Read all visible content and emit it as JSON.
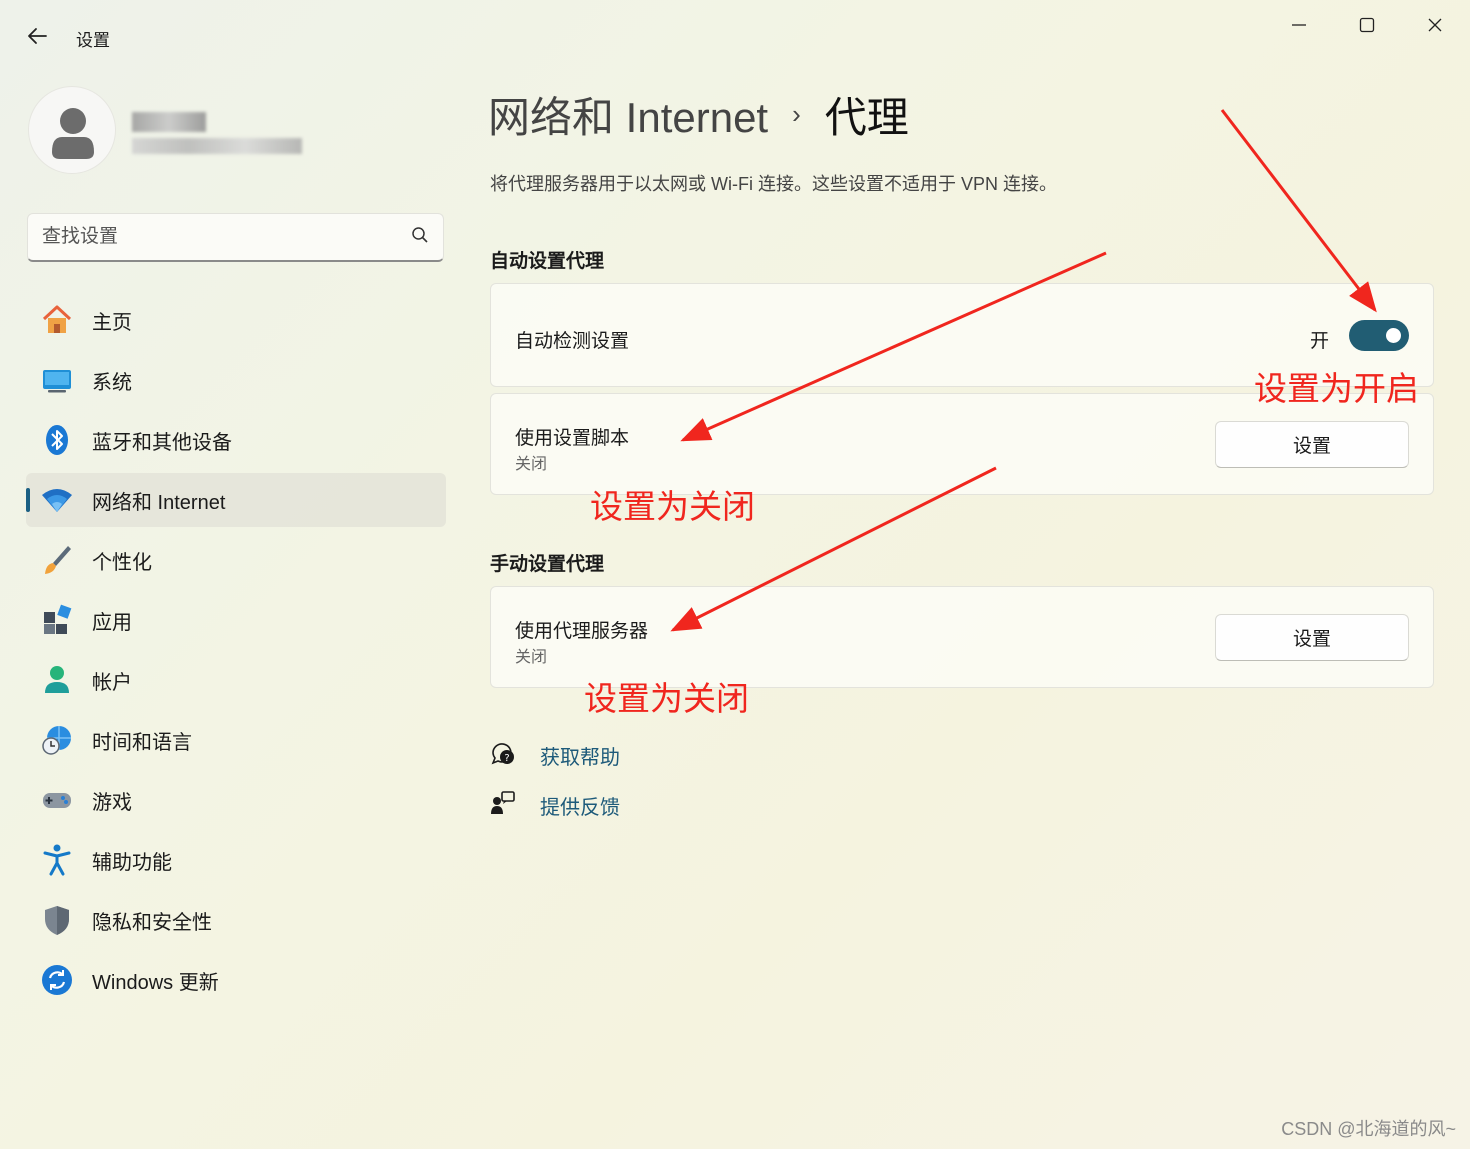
{
  "window": {
    "title": "设置"
  },
  "search": {
    "placeholder": "查找设置"
  },
  "nav": [
    {
      "label": "主页",
      "icon": "home-icon"
    },
    {
      "label": "系统",
      "icon": "monitor-icon"
    },
    {
      "label": "蓝牙和其他设备",
      "icon": "bluetooth-icon"
    },
    {
      "label": "网络和 Internet",
      "icon": "wifi-icon",
      "active": true
    },
    {
      "label": "个性化",
      "icon": "brush-icon"
    },
    {
      "label": "应用",
      "icon": "apps-icon"
    },
    {
      "label": "帐户",
      "icon": "person-icon"
    },
    {
      "label": "时间和语言",
      "icon": "globe-clock-icon"
    },
    {
      "label": "游戏",
      "icon": "gamepad-icon"
    },
    {
      "label": "辅助功能",
      "icon": "accessibility-icon"
    },
    {
      "label": "隐私和安全性",
      "icon": "shield-icon"
    },
    {
      "label": "Windows 更新",
      "icon": "update-icon"
    }
  ],
  "header": {
    "breadcrumb_parent": "网络和 Internet",
    "breadcrumb_separator": "›",
    "breadcrumb_current": "代理",
    "description": "将代理服务器用于以太网或 Wi-Fi 连接。这些设置不适用于 VPN 连接。"
  },
  "auto_section": {
    "title": "自动设置代理",
    "detect": {
      "label": "自动检测设置",
      "state": "开",
      "on": true
    },
    "script": {
      "label": "使用设置脚本",
      "status": "关闭",
      "button": "设置"
    }
  },
  "manual_section": {
    "title": "手动设置代理",
    "proxy": {
      "label": "使用代理服务器",
      "status": "关闭",
      "button": "设置"
    }
  },
  "links": {
    "help": "获取帮助",
    "feedback": "提供反馈"
  },
  "annotations": {
    "turn_on": "设置为开启",
    "turn_off_script": "设置为关闭",
    "turn_off_proxy": "设置为关闭",
    "color": "#f0261e"
  },
  "watermark": "CSDN @北海道的风~"
}
